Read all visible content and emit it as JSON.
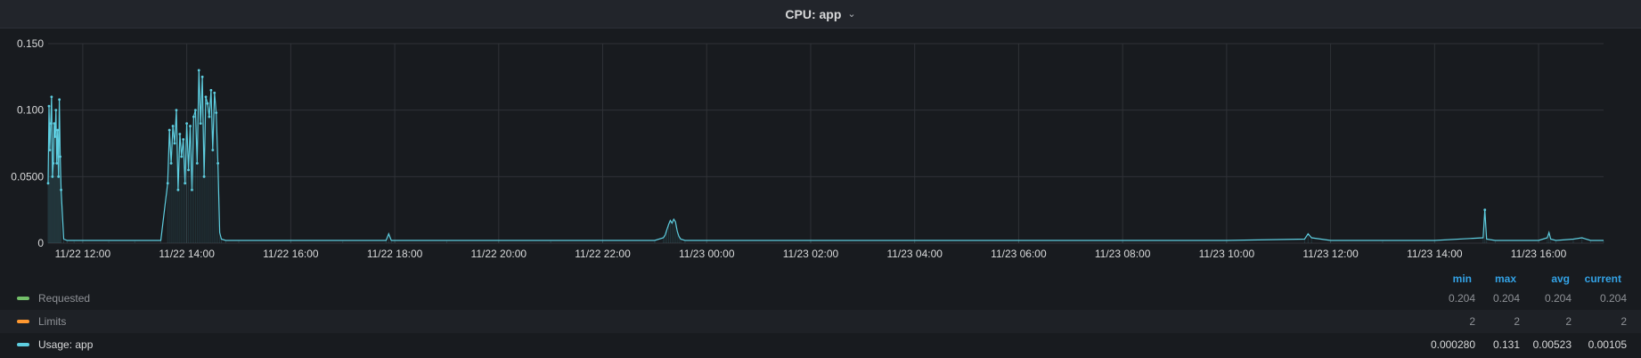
{
  "panel": {
    "title": "CPU: app",
    "chevron": "chevron-down-icon"
  },
  "chart_data": {
    "type": "line",
    "title": "CPU: app",
    "ylim": [
      0,
      0.15
    ],
    "y_ticks": [
      "0.150",
      "0.100",
      "0.0500",
      "0"
    ],
    "y_tick_values": [
      0.15,
      0.1,
      0.05,
      0
    ],
    "x_range": [
      "11/22 11:20",
      "11/23 17:15"
    ],
    "x_ticks": [
      "11/22 12:00",
      "11/22 14:00",
      "11/22 16:00",
      "11/22 18:00",
      "11/22 20:00",
      "11/22 22:00",
      "11/23 00:00",
      "11/23 02:00",
      "11/23 04:00",
      "11/23 06:00",
      "11/23 08:00",
      "11/23 10:00",
      "11/23 12:00",
      "11/23 14:00",
      "11/23 16:00"
    ],
    "grid": true,
    "colors": {
      "requested": "#73bf69",
      "limits": "#ff9830",
      "usage": "#5ecee0"
    },
    "series": [
      {
        "name": "Usage: app",
        "x": [
          "11/22 11:20",
          "11/22 11:21",
          "11/22 11:22",
          "11/22 11:23",
          "11/22 11:24",
          "11/22 11:25",
          "11/22 11:26",
          "11/22 11:27",
          "11/22 11:28",
          "11/22 11:29",
          "11/22 11:30",
          "11/22 11:31",
          "11/22 11:32",
          "11/22 11:33",
          "11/22 11:34",
          "11/22 11:35",
          "11/22 11:38",
          "11/22 11:42",
          "11/22 11:50",
          "11/22 12:00",
          "11/22 12:30",
          "11/22 13:00",
          "11/22 13:30",
          "11/22 13:38",
          "11/22 13:40",
          "11/22 13:42",
          "11/22 13:44",
          "11/22 13:46",
          "11/22 13:48",
          "11/22 13:50",
          "11/22 13:52",
          "11/22 13:54",
          "11/22 13:56",
          "11/22 13:58",
          "11/22 14:00",
          "11/22 14:02",
          "11/22 14:04",
          "11/22 14:06",
          "11/22 14:08",
          "11/22 14:10",
          "11/22 14:12",
          "11/22 14:14",
          "11/22 14:16",
          "11/22 14:18",
          "11/22 14:20",
          "11/22 14:22",
          "11/22 14:24",
          "11/22 14:26",
          "11/22 14:28",
          "11/22 14:30",
          "11/22 14:32",
          "11/22 14:34",
          "11/22 14:36",
          "11/22 14:38",
          "11/22 14:40",
          "11/22 14:45",
          "11/22 15:00",
          "11/22 16:00",
          "11/22 17:00",
          "11/22 17:50",
          "11/22 17:53",
          "11/22 17:56",
          "11/22 18:00",
          "11/22 19:00",
          "11/22 20:00",
          "11/22 21:00",
          "11/22 22:00",
          "11/22 23:00",
          "11/22 23:10",
          "11/22 23:12",
          "11/22 23:14",
          "11/22 23:16",
          "11/22 23:18",
          "11/22 23:20",
          "11/22 23:22",
          "11/22 23:24",
          "11/22 23:26",
          "11/22 23:28",
          "11/22 23:30",
          "11/22 23:35",
          "11/23 00:00",
          "11/23 02:00",
          "11/23 04:00",
          "11/23 06:00",
          "11/23 08:00",
          "11/23 10:00",
          "11/23 11:30",
          "11/23 11:34",
          "11/23 11:38",
          "11/23 12:00",
          "11/23 13:00",
          "11/23 14:00",
          "11/23 14:56",
          "11/23 14:58",
          "11/23 15:00",
          "11/23 15:10",
          "11/23 16:00",
          "11/23 16:10",
          "11/23 16:12",
          "11/23 16:14",
          "11/23 16:20",
          "11/23 16:40",
          "11/23 16:50",
          "11/23 17:00",
          "11/23 17:15"
        ],
        "values": [
          0.045,
          0.103,
          0.07,
          0.09,
          0.11,
          0.05,
          0.06,
          0.09,
          0.08,
          0.1,
          0.06,
          0.085,
          0.05,
          0.108,
          0.065,
          0.04,
          0.003,
          0.002,
          0.002,
          0.002,
          0.002,
          0.002,
          0.002,
          0.045,
          0.085,
          0.06,
          0.088,
          0.075,
          0.1,
          0.04,
          0.082,
          0.065,
          0.078,
          0.045,
          0.09,
          0.055,
          0.088,
          0.04,
          0.095,
          0.1,
          0.06,
          0.13,
          0.09,
          0.125,
          0.05,
          0.11,
          0.105,
          0.095,
          0.115,
          0.07,
          0.113,
          0.098,
          0.06,
          0.008,
          0.003,
          0.002,
          0.002,
          0.002,
          0.002,
          0.002,
          0.007,
          0.002,
          0.002,
          0.002,
          0.002,
          0.002,
          0.002,
          0.002,
          0.004,
          0.006,
          0.01,
          0.014,
          0.017,
          0.015,
          0.018,
          0.016,
          0.009,
          0.005,
          0.003,
          0.002,
          0.002,
          0.002,
          0.002,
          0.002,
          0.002,
          0.002,
          0.003,
          0.007,
          0.004,
          0.002,
          0.002,
          0.002,
          0.004,
          0.025,
          0.003,
          0.002,
          0.002,
          0.004,
          0.008,
          0.003,
          0.002,
          0.003,
          0.004,
          0.002,
          0.002
        ]
      }
    ]
  },
  "legend": {
    "columns": [
      "min",
      "max",
      "avg",
      "current"
    ],
    "rows": [
      {
        "name": "Requested",
        "color": "#73bf69",
        "dim": true,
        "values": [
          "0.204",
          "0.204",
          "0.204",
          "0.204"
        ]
      },
      {
        "name": "Limits",
        "color": "#ff9830",
        "dim": true,
        "values": [
          "2",
          "2",
          "2",
          "2"
        ]
      },
      {
        "name": "Usage: app",
        "color": "#5ecee0",
        "dim": false,
        "values": [
          "0.000280",
          "0.131",
          "0.00523",
          "0.00105"
        ]
      }
    ]
  }
}
